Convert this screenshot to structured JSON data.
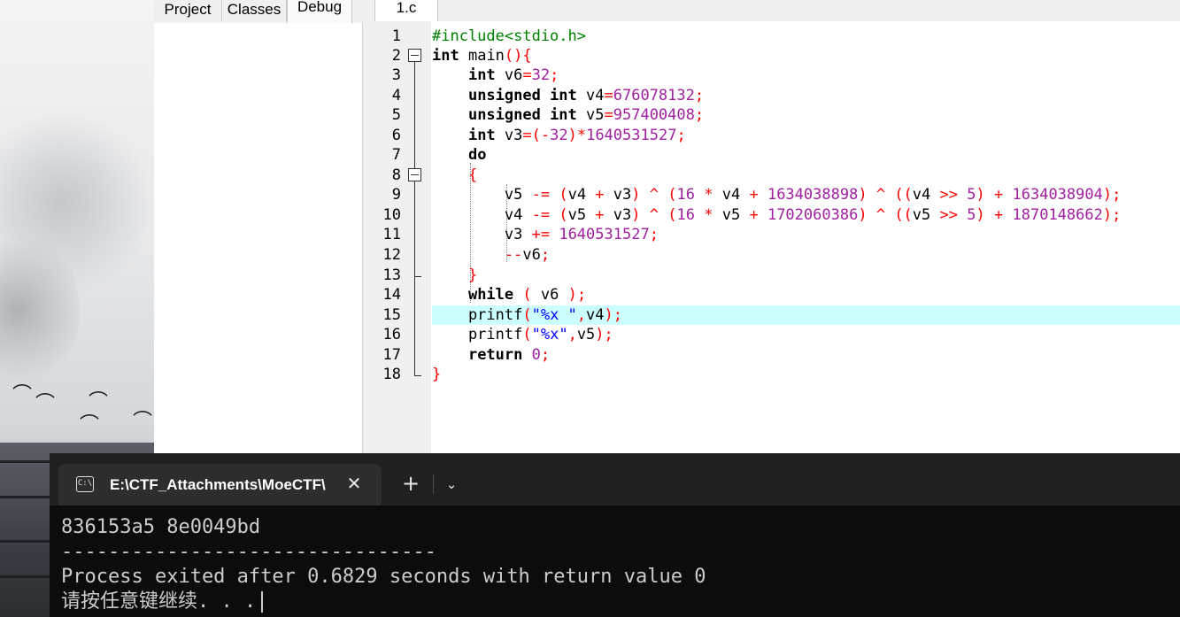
{
  "ide": {
    "panel_tabs": [
      "Project",
      "Classes",
      "Debug"
    ],
    "active_panel_tab": "Debug",
    "file_tab": "1.c",
    "line_numbers": [
      "1",
      "2",
      "3",
      "4",
      "5",
      "6",
      "7",
      "8",
      "9",
      "10",
      "11",
      "12",
      "13",
      "14",
      "15",
      "16",
      "17",
      "18"
    ],
    "highlighted_line": "15",
    "code_lines": [
      "#include<stdio.h>",
      "int main(){",
      "    int v6=32;",
      "    unsigned int v4=676078132;",
      "    unsigned int v5=957400408;",
      "    int v3=(-32)*1640531527;",
      "    do",
      "    {",
      "        v5 -= (v4 + v3) ^ (16 * v4 + 1634038898) ^ ((v4 >> 5) + 1634038904);",
      "        v4 -= (v5 + v3) ^ (16 * v5 + 1702060386) ^ ((v5 >> 5) + 1870148662);",
      "        v3 += 1640531527;",
      "        --v6;",
      "    }",
      "    while ( v6 );",
      "    printf(\"%x \",v4);",
      "    printf(\"%x\",v5);",
      "    return 0;",
      "}"
    ]
  },
  "terminal": {
    "tab_title": "E:\\CTF_Attachments\\MoeCTF\\",
    "tab_icon": "terminal-icon",
    "new_tab_label": "+",
    "output_lines": [
      "836153a5 8e0049bd",
      "--------------------------------",
      "Process exited after 0.6829 seconds with return value 0",
      "请按任意键继续. . ."
    ]
  },
  "colors": {
    "keyword": "#000000",
    "number": "#a020a0",
    "symbol": "#ff0000",
    "string": "#0000ff",
    "preprocessor": "#008000",
    "line_highlight": "#ccffff",
    "terminal_bg": "#0c0c0c"
  }
}
